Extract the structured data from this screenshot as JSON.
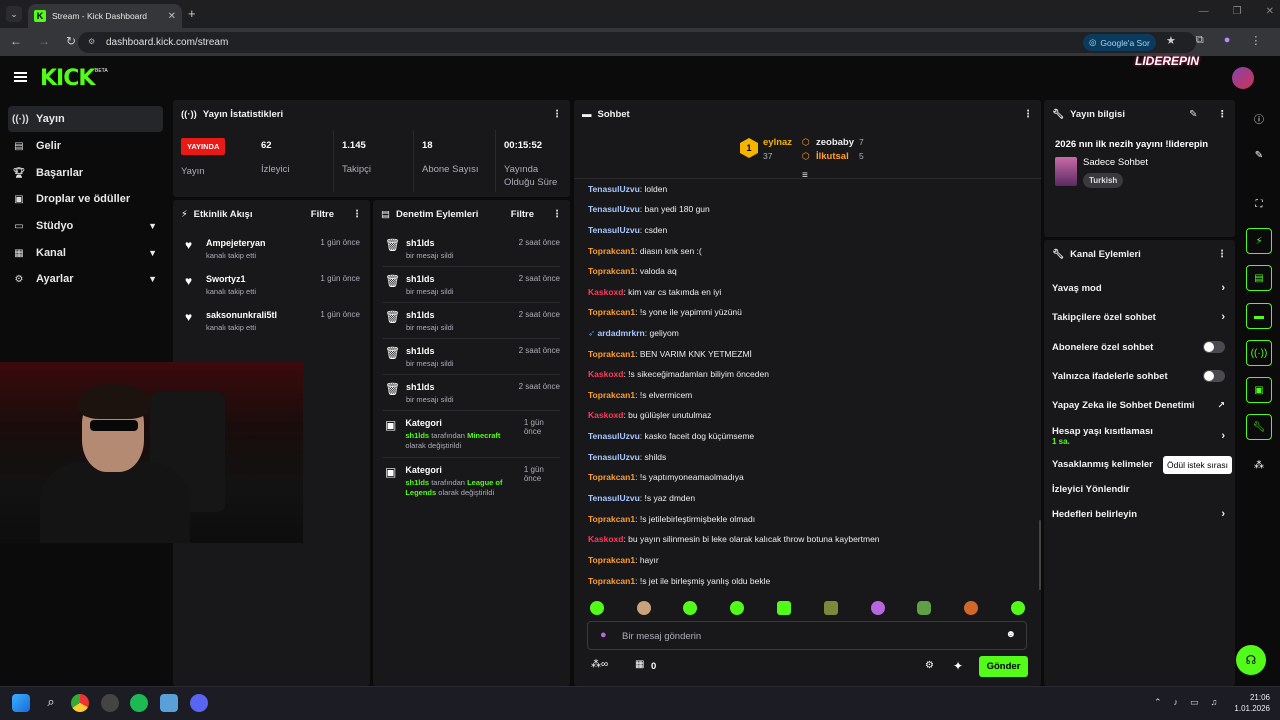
{
  "browser": {
    "tab_title": "Stream - Kick Dashboard",
    "url": "dashboard.kick.com/stream",
    "google_button": "Google'a Sor"
  },
  "header": {
    "logo": "KICK",
    "beta": "BETA",
    "overlay_brand": "LIDEREPIN"
  },
  "sidebar": {
    "items": [
      {
        "label": "Yayın",
        "icon": "broadcast-icon"
      },
      {
        "label": "Gelir",
        "icon": "revenue-icon"
      },
      {
        "label": "Başarılar",
        "icon": "trophy-icon"
      },
      {
        "label": "Droplar ve ödüller",
        "icon": "gift-icon"
      },
      {
        "label": "Stüdyo",
        "icon": "studio-icon"
      },
      {
        "label": "Kanal",
        "icon": "channel-icon"
      },
      {
        "label": "Ayarlar",
        "icon": "gear-icon"
      }
    ]
  },
  "stats": {
    "title": "Yayın İstatistikleri",
    "live_badge": "YAYINDA",
    "cards": [
      {
        "value": "",
        "label": "Yayın"
      },
      {
        "value": "62",
        "label": "İzleyici"
      },
      {
        "value": "1.145",
        "label": "Takipçi"
      },
      {
        "value": "18",
        "label": "Abone Sayısı"
      },
      {
        "value": "00:15:52",
        "label": "Yayında Olduğu Süre"
      }
    ]
  },
  "activity": {
    "title": "Etkinlik Akışı",
    "filter": "Filtre",
    "items": [
      {
        "name": "Ampejeteryan",
        "sub": "kanalı takip etti",
        "time": "1 gün önce"
      },
      {
        "name": "Swortyz1",
        "sub": "kanalı takip etti",
        "time": "1 gün önce"
      },
      {
        "name": "saksonunkrali5tl",
        "sub": "kanalı takip etti",
        "time": "1 gün önce"
      }
    ]
  },
  "moderation": {
    "title": "Denetim Eylemleri",
    "filter": "Filtre",
    "items": [
      {
        "name": "sh1lds",
        "sub": "bir mesajı sildi",
        "time": "2 saat önce"
      },
      {
        "name": "sh1lds",
        "sub": "bir mesajı sildi",
        "time": "2 saat önce"
      },
      {
        "name": "sh1lds",
        "sub": "bir mesajı sildi",
        "time": "2 saat önce"
      },
      {
        "name": "sh1lds",
        "sub": "bir mesajı sildi",
        "time": "2 saat önce"
      },
      {
        "name": "sh1lds",
        "sub": "bir mesajı sildi",
        "time": "2 saat önce"
      }
    ],
    "category_items": [
      {
        "name": "Kategori",
        "user": "sh1lds",
        "mid": "tarafından",
        "game": "Minecraft",
        "end": "olarak değiştirildi",
        "time": "1 gün önce"
      },
      {
        "name": "Kategori",
        "user": "sh1lds",
        "mid": "tarafından",
        "game": "League of Legends",
        "end": "olarak değiştirildi",
        "time": "1 gün önce"
      }
    ]
  },
  "chat": {
    "title": "Sohbet",
    "leaders": [
      {
        "rank": "1",
        "name": "eylnaz",
        "count": "37"
      },
      {
        "name": "zeobaby",
        "count": "7"
      },
      {
        "name": "İlkutsal",
        "count": "5"
      }
    ],
    "messages": [
      {
        "user": "TenasulUzvu",
        "color": "#a8c8ff",
        "text": "lolden"
      },
      {
        "user": "TenasulUzvu",
        "color": "#a8c8ff",
        "text": "ban yedi 180 gun"
      },
      {
        "user": "TenasulUzvu",
        "color": "#a8c8ff",
        "text": "csden"
      },
      {
        "user": "Toprakcan1",
        "color": "#ff9e2c",
        "text": "diasın knk sen :("
      },
      {
        "user": "Toprakcan1",
        "color": "#ff9e2c",
        "text": "valoda aq"
      },
      {
        "user": "Kaskoxd",
        "color": "#ff3b5c",
        "text": "kim var cs takımda en iyi"
      },
      {
        "user": "Toprakcan1",
        "color": "#ff9e2c",
        "text": "!s yone ile yapimmi yüzünü"
      },
      {
        "user": "ardadmrkrn",
        "color": "#a8c8ff",
        "text": "geliyom"
      },
      {
        "user": "Toprakcan1",
        "color": "#ff9e2c",
        "text": "BEN VARIM KNK YETMEZMİ"
      },
      {
        "user": "Kaskoxd",
        "color": "#ff3b5c",
        "text": "!s sikeceğimadamları biliyim önceden"
      },
      {
        "user": "Toprakcan1",
        "color": "#ff9e2c",
        "text": "!s elvermicem"
      },
      {
        "user": "Kaskoxd",
        "color": "#ff3b5c",
        "text": "bu gülüşler unutulmaz"
      },
      {
        "user": "TenasulUzvu",
        "color": "#a8c8ff",
        "text": "kasko faceit dog küçümseme"
      },
      {
        "user": "TenasulUzvu",
        "color": "#a8c8ff",
        "text": "shilds"
      },
      {
        "user": "Toprakcan1",
        "color": "#ff9e2c",
        "text": "!s yaptımyoneamaolmadıya"
      },
      {
        "user": "TenasulUzvu",
        "color": "#a8c8ff",
        "text": "!s yaz dmden"
      },
      {
        "user": "Toprakcan1",
        "color": "#ff9e2c",
        "text": "!s jetilebirleştirmişbekle olmadı"
      },
      {
        "user": "Kaskoxd",
        "color": "#ff3b5c",
        "text": "bu yayın silinmesin bi leke olarak kalıcak throw botuna kaybertmen"
      },
      {
        "user": "Toprakcan1",
        "color": "#ff9e2c",
        "text": "hayır"
      },
      {
        "user": "Toprakcan1",
        "color": "#ff9e2c",
        "text": "!s jet ile birleşmiş yanlış oldu bekle"
      }
    ],
    "input_placeholder": "Bir mesaj gönderin",
    "points": "0",
    "send": "Gönder"
  },
  "stream_info": {
    "title": "Yayın bilgisi",
    "stream_title": "2026 nın ilk nezih yayını !liderepin",
    "category": "Sadece Sohbet",
    "tag": "Turkish"
  },
  "channel_actions": {
    "title": "Kanal Eylemleri",
    "items": [
      {
        "label": "Yavaş mod",
        "kind": "chevron"
      },
      {
        "label": "Takipçilere özel sohbet",
        "kind": "chevron"
      },
      {
        "label": "Abonelere özel sohbet",
        "kind": "toggle"
      },
      {
        "label": "Yalnızca ifadelerle sohbet",
        "kind": "toggle"
      },
      {
        "label": "Yapay Zeka ile Sohbet Denetimi",
        "kind": "external"
      },
      {
        "label": "Hesap yaşı kısıtlaması",
        "sub": "1 sa.",
        "kind": "chevron"
      },
      {
        "label": "Yasaklanmış kelimeler",
        "kind": "none"
      },
      {
        "label": "İzleyici Yönlendir",
        "kind": "none"
      },
      {
        "label": "Hedefleri belirleyin",
        "kind": "chevron"
      }
    ],
    "tooltip": "Ödül istek sırası"
  },
  "taskbar": {
    "time": "21:06",
    "date": "1.01.2026"
  },
  "colors": {
    "accent": "#53fc18",
    "live": "#e91916",
    "panel": "#18181b"
  }
}
